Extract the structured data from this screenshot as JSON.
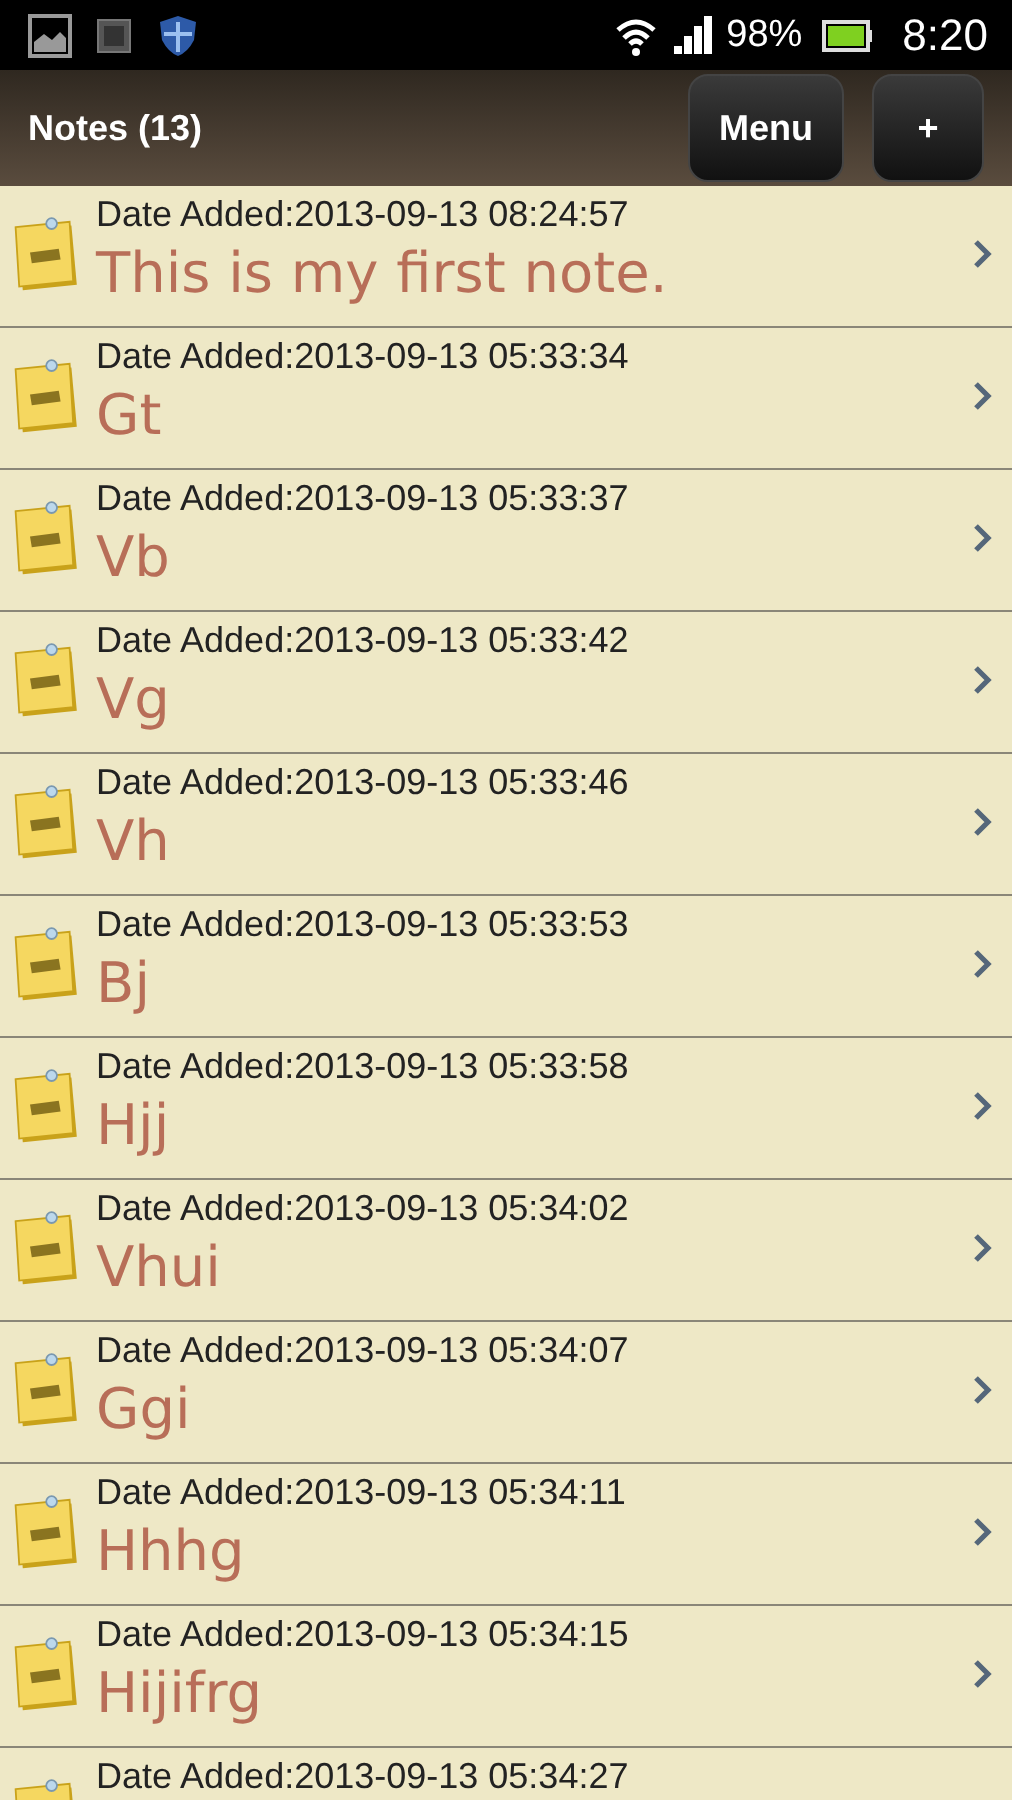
{
  "status_bar": {
    "battery": "98%",
    "time": "8:20"
  },
  "header": {
    "title": "Notes (13)",
    "buttons": [
      "Menu",
      "+"
    ]
  },
  "notes": [
    {
      "date": "Date Added:2013-09-13 08:24:57",
      "title": "This is my first note."
    },
    {
      "date": "Date Added:2013-09-13 05:33:34",
      "title": "Gt"
    },
    {
      "date": "Date Added:2013-09-13 05:33:37",
      "title": "Vb"
    },
    {
      "date": "Date Added:2013-09-13 05:33:42",
      "title": "Vg"
    },
    {
      "date": "Date Added:2013-09-13 05:33:46",
      "title": "Vh"
    },
    {
      "date": "Date Added:2013-09-13 05:33:53",
      "title": "Bj"
    },
    {
      "date": "Date Added:2013-09-13 05:33:58",
      "title": "Hjj"
    },
    {
      "date": "Date Added:2013-09-13 05:34:02",
      "title": "Vhui"
    },
    {
      "date": "Date Added:2013-09-13 05:34:07",
      "title": "Ggi"
    },
    {
      "date": "Date Added:2013-09-13 05:34:11",
      "title": "Hhhg"
    },
    {
      "date": "Date Added:2013-09-13 05:34:15",
      "title": "Hijifrg"
    },
    {
      "date": "Date Added:2013-09-13 05:34:27"
    }
  ]
}
